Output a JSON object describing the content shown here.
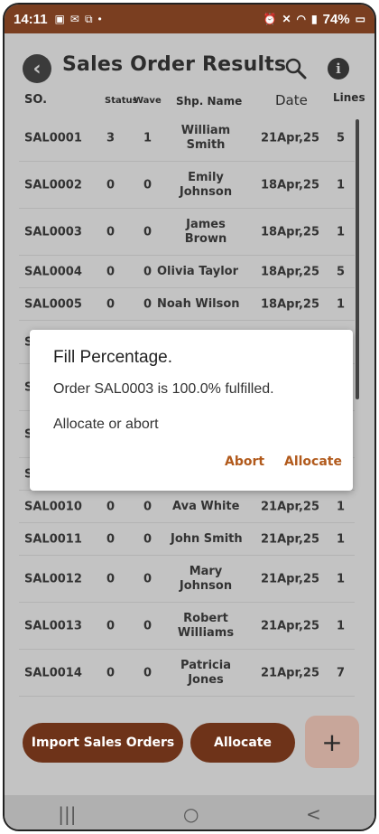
{
  "status_bar": {
    "time": "14:11",
    "left_icons": [
      "photo-icon",
      "mail-icon",
      "cast-icon",
      "dot-icon"
    ],
    "battery": "74%"
  },
  "header": {
    "title": "Sales Order Results"
  },
  "columns": {
    "so": "SO.",
    "status": "Status",
    "wave": "Wave",
    "name": "Shp. Name",
    "date": "Date",
    "lines": "Lines"
  },
  "rows": [
    {
      "so": "SAL0001",
      "status": "3",
      "wave": "1",
      "name1": "William",
      "name2": "Smith",
      "date": "21Apr,25",
      "lines": "5"
    },
    {
      "so": "SAL0002",
      "status": "0",
      "wave": "0",
      "name1": "Emily",
      "name2": "Johnson",
      "date": "18Apr,25",
      "lines": "1"
    },
    {
      "so": "SAL0003",
      "status": "0",
      "wave": "0",
      "name1": "James",
      "name2": "Brown",
      "date": "18Apr,25",
      "lines": "1"
    },
    {
      "so": "SAL0004",
      "status": "0",
      "wave": "0",
      "name1": "Olivia  Taylor",
      "name2": "",
      "date": "18Apr,25",
      "lines": "5"
    },
    {
      "so": "SAL0005",
      "status": "0",
      "wave": "0",
      "name1": "Noah  Wilson",
      "name2": "",
      "date": "18Apr,25",
      "lines": "1"
    }
  ],
  "rows_bottom": [
    {
      "so": "SAL0010",
      "status": "0",
      "wave": "0",
      "name1": "Ava  White",
      "name2": "",
      "date": "21Apr,25",
      "lines": "1"
    },
    {
      "so": "SAL0011",
      "status": "0",
      "wave": "0",
      "name1": "John  Smith",
      "name2": "",
      "date": "21Apr,25",
      "lines": "1"
    },
    {
      "so": "SAL0012",
      "status": "0",
      "wave": "0",
      "name1": "Mary",
      "name2": "Johnson",
      "date": "21Apr,25",
      "lines": "1"
    },
    {
      "so": "SAL0013",
      "status": "0",
      "wave": "0",
      "name1": "Robert",
      "name2": "Williams",
      "date": "21Apr,25",
      "lines": "1"
    },
    {
      "so": "SAL0014",
      "status": "0",
      "wave": "0",
      "name1": "Patricia",
      "name2": "Jones",
      "date": "21Apr,25",
      "lines": "7"
    }
  ],
  "hidden_row_prefix": "S",
  "dialog": {
    "title": "Fill Percentage.",
    "message": "Order SAL0003 is 100.0% fulfilled.",
    "prompt": "Allocate or abort",
    "abort_label": "Abort",
    "allocate_label": "Allocate"
  },
  "actions": {
    "import_label": "Import Sales Orders",
    "allocate_label": "Allocate",
    "add_label": "+"
  },
  "nav": {
    "recents": "|||",
    "home": "○",
    "back": "<"
  },
  "colors": {
    "accent": "#b15a1c",
    "button": "#6e3319",
    "status_bar": "#7a3e20",
    "background": "#c3c3c3",
    "fab": "#c8a69a"
  }
}
